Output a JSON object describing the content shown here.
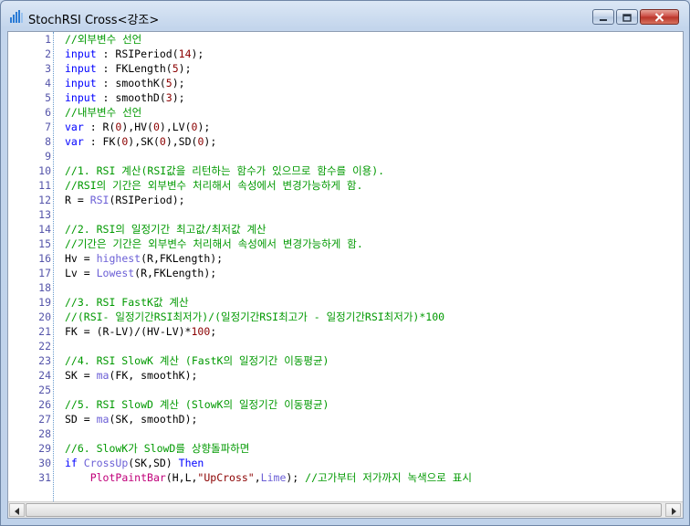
{
  "window": {
    "title": "StochRSI Cross<강조>"
  },
  "icons": {
    "app": "chart-bars-icon",
    "minimize": "minimize-icon",
    "maximize": "maximize-icon",
    "close": "close-icon",
    "scroll_left": "arrow-left-icon",
    "scroll_right": "arrow-right-icon"
  },
  "colors": {
    "keyword": "#0000ff",
    "function": "#6b5fd6",
    "comment": "#009900",
    "number": "#8b0000",
    "drawing": "#c0007a",
    "close_button": "#c9463d"
  },
  "editor": {
    "lines": [
      {
        "n": "1",
        "t": [
          [
            "cm",
            "//외부변수 선언"
          ]
        ]
      },
      {
        "n": "2",
        "t": [
          [
            "kw",
            "input"
          ],
          [
            "op",
            " : RSIPeriod("
          ],
          [
            "num",
            "14"
          ],
          [
            "op",
            ");"
          ]
        ]
      },
      {
        "n": "3",
        "t": [
          [
            "kw",
            "input"
          ],
          [
            "op",
            " : FKLength("
          ],
          [
            "num",
            "5"
          ],
          [
            "op",
            ");"
          ]
        ]
      },
      {
        "n": "4",
        "t": [
          [
            "kw",
            "input"
          ],
          [
            "op",
            " : smoothK("
          ],
          [
            "num",
            "5"
          ],
          [
            "op",
            ");"
          ]
        ]
      },
      {
        "n": "5",
        "t": [
          [
            "kw",
            "input"
          ],
          [
            "op",
            " : smoothD("
          ],
          [
            "num",
            "3"
          ],
          [
            "op",
            ");"
          ]
        ]
      },
      {
        "n": "6",
        "t": [
          [
            "cm",
            "//내부변수 선언"
          ]
        ]
      },
      {
        "n": "7",
        "t": [
          [
            "kw",
            "var"
          ],
          [
            "op",
            " : R("
          ],
          [
            "num",
            "0"
          ],
          [
            "op",
            "),HV("
          ],
          [
            "num",
            "0"
          ],
          [
            "op",
            "),LV("
          ],
          [
            "num",
            "0"
          ],
          [
            "op",
            ");"
          ]
        ]
      },
      {
        "n": "8",
        "t": [
          [
            "kw",
            "var"
          ],
          [
            "op",
            " : FK("
          ],
          [
            "num",
            "0"
          ],
          [
            "op",
            "),SK("
          ],
          [
            "num",
            "0"
          ],
          [
            "op",
            "),SD("
          ],
          [
            "num",
            "0"
          ],
          [
            "op",
            ");"
          ]
        ]
      },
      {
        "n": "9",
        "t": []
      },
      {
        "n": "10",
        "t": [
          [
            "cm",
            "//1. RSI 계산(RSI값을 리턴하는 함수가 있으므로 함수를 이용)."
          ]
        ]
      },
      {
        "n": "11",
        "t": [
          [
            "cm",
            "//RSI의 기간은 외부변수 처리해서 속성에서 변경가능하게 함."
          ]
        ]
      },
      {
        "n": "12",
        "t": [
          [
            "op",
            "R = "
          ],
          [
            "fn",
            "RSI"
          ],
          [
            "op",
            "(RSIPeriod);"
          ]
        ]
      },
      {
        "n": "13",
        "t": []
      },
      {
        "n": "14",
        "t": [
          [
            "cm",
            "//2. RSI의 일정기간 최고값/최저값 계산"
          ]
        ]
      },
      {
        "n": "15",
        "t": [
          [
            "cm",
            "//기간은 기간은 외부변수 처리해서 속성에서 변경가능하게 함."
          ]
        ]
      },
      {
        "n": "16",
        "t": [
          [
            "op",
            "Hv = "
          ],
          [
            "fn",
            "highest"
          ],
          [
            "op",
            "(R,FKLength);"
          ]
        ]
      },
      {
        "n": "17",
        "t": [
          [
            "op",
            "Lv = "
          ],
          [
            "fn",
            "Lowest"
          ],
          [
            "op",
            "(R,FKLength);"
          ]
        ]
      },
      {
        "n": "18",
        "t": []
      },
      {
        "n": "19",
        "t": [
          [
            "cm",
            "//3. RSI FastK값 계산"
          ]
        ]
      },
      {
        "n": "20",
        "t": [
          [
            "cm",
            "//(RSI- 일정기간RSI최저가)/(일정기간RSI최고가 - 일정기간RSI최저가)*100"
          ]
        ]
      },
      {
        "n": "21",
        "t": [
          [
            "op",
            "FK = (R-LV)/(HV-LV)*"
          ],
          [
            "num",
            "100"
          ],
          [
            "op",
            ";"
          ]
        ]
      },
      {
        "n": "22",
        "t": []
      },
      {
        "n": "23",
        "t": [
          [
            "cm",
            "//4. RSI SlowK 계산 (FastK의 일정기간 이동평균)"
          ]
        ]
      },
      {
        "n": "24",
        "t": [
          [
            "op",
            "SK = "
          ],
          [
            "fn",
            "ma"
          ],
          [
            "op",
            "(FK, smoothK);"
          ]
        ]
      },
      {
        "n": "25",
        "t": []
      },
      {
        "n": "26",
        "t": [
          [
            "cm",
            "//5. RSI SlowD 계산 (SlowK의 일정기간 이동평균)"
          ]
        ]
      },
      {
        "n": "27",
        "t": [
          [
            "op",
            "SD = "
          ],
          [
            "fn",
            "ma"
          ],
          [
            "op",
            "(SK, smoothD);"
          ]
        ]
      },
      {
        "n": "28",
        "t": []
      },
      {
        "n": "29",
        "t": [
          [
            "cm",
            "//6. SlowK가 SlowD를 상향돌파하면"
          ]
        ]
      },
      {
        "n": "30",
        "t": [
          [
            "kw",
            "if"
          ],
          [
            "op",
            " "
          ],
          [
            "fn",
            "CrossUp"
          ],
          [
            "op",
            "(SK,SD) "
          ],
          [
            "kw",
            "Then"
          ]
        ]
      },
      {
        "n": "31",
        "t": [
          [
            "op",
            "    "
          ],
          [
            "draw",
            "PlotPaintBar"
          ],
          [
            "op",
            "(H,L,"
          ],
          [
            "str",
            "\"UpCross\""
          ],
          [
            "op",
            ","
          ],
          [
            "fn",
            "Lime"
          ],
          [
            "op",
            "); "
          ],
          [
            "cm",
            "//고가부터 저가까지 녹색으로 표시"
          ]
        ]
      }
    ]
  }
}
